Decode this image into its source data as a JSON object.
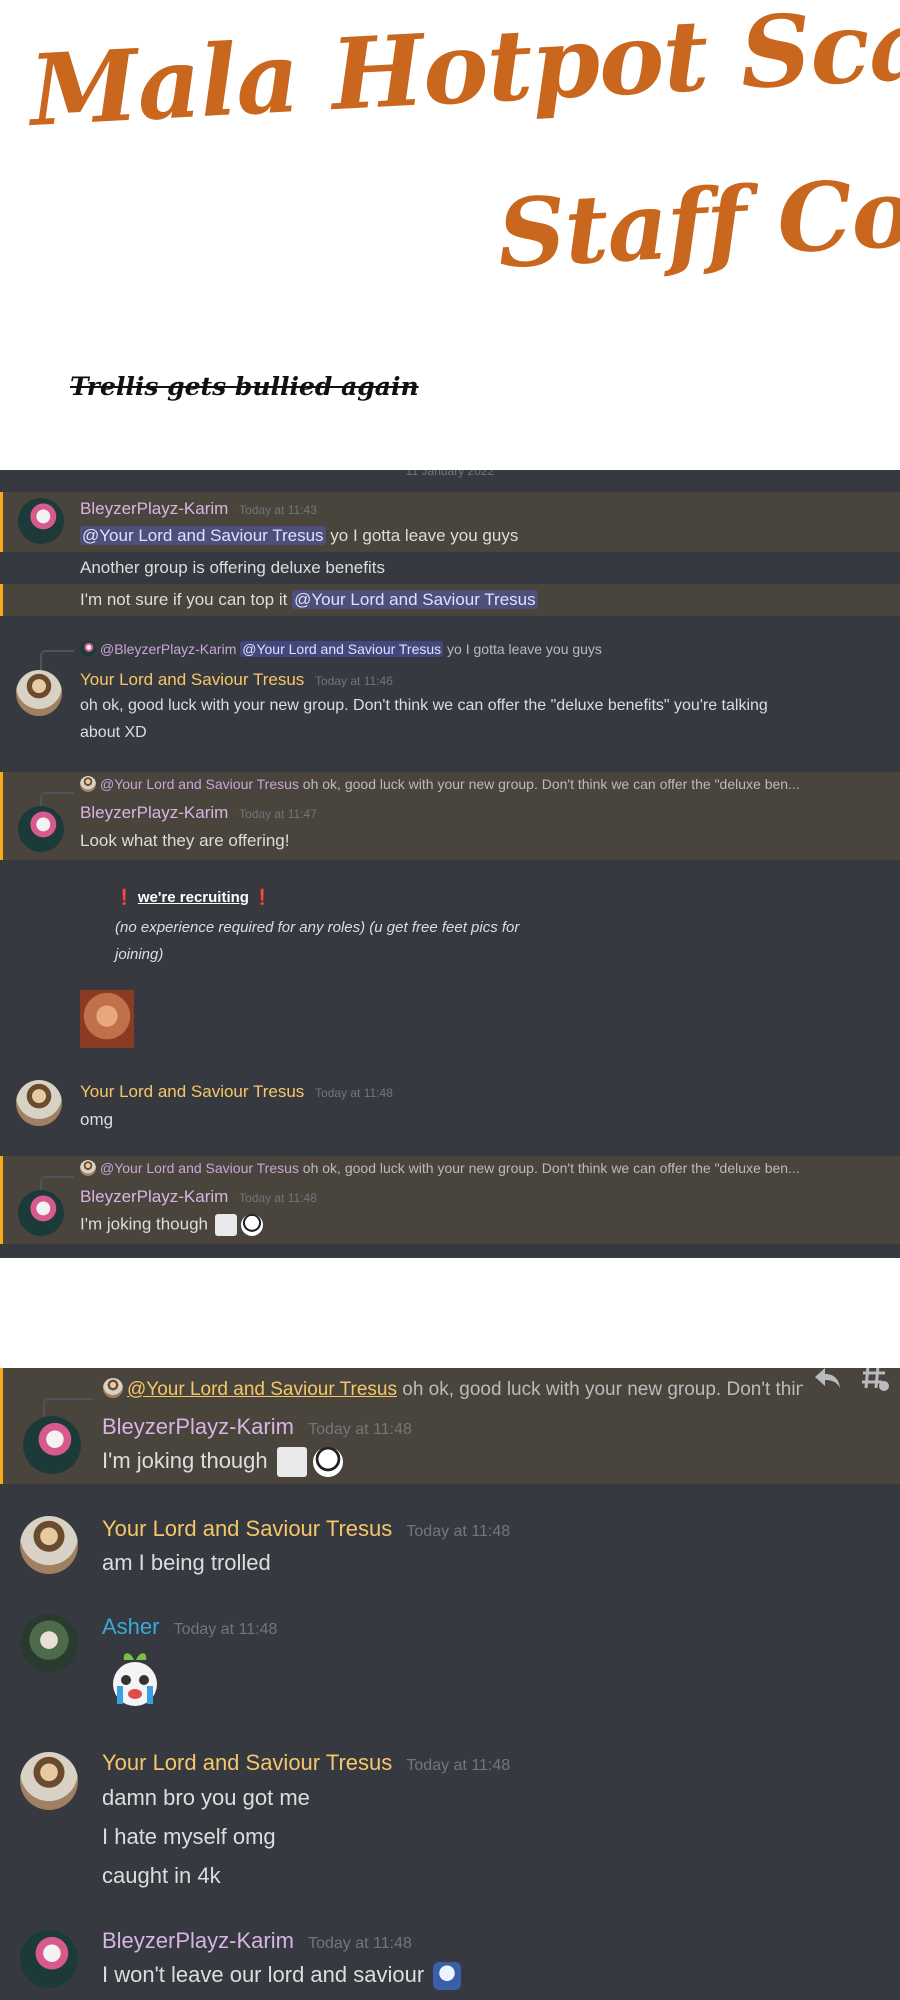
{
  "header": {
    "title_line1": "Mala Hotpot Scans",
    "title_line2": "Staff Corner",
    "subtitle": "Trellis gets bullied again"
  },
  "panel1": {
    "date_divider": "11 January 2022",
    "m1": {
      "author": "BleyzerPlayz-Karim",
      "time": "Today at 11:43",
      "line1_mention": "@Your Lord and Saviour Tresus",
      "line1_text": " yo I gotta leave you guys",
      "line2": "Another group is offering deluxe benefits",
      "line3_text": "I'm not sure if you can top it ",
      "line3_mention": "@Your Lord and Saviour Tresus"
    },
    "m2": {
      "reply_author": "@BleyzerPlayz-Karim",
      "reply_mention": "@Your Lord and Saviour Tresus",
      "reply_text": " yo I gotta leave you guys",
      "author": "Your Lord and Saviour Tresus",
      "time": "Today at 11:46",
      "text_line1": "oh ok, good luck with your new group. Don't think we can offer the \"deluxe benefits\" you're talking",
      "text_line2": "about XD"
    },
    "m3": {
      "reply_author": "@Your Lord and Saviour Tresus",
      "reply_text": " oh ok, good luck with your new group. Don't think we can offer the \"deluxe ben...",
      "author": "BleyzerPlayz-Karim",
      "time": "Today at 11:47",
      "text": "Look what they are offering!",
      "embed_excl": "❗",
      "embed_title": "we're recruiting",
      "embed_desc": "(no experience required for any roles) (u get free feet pics for joining)"
    },
    "m4": {
      "author": "Your Lord and Saviour Tresus",
      "time": "Today at 11:48",
      "text": "omg"
    },
    "m5": {
      "reply_author": "@Your Lord and Saviour Tresus",
      "reply_text": " oh ok, good luck with your new group. Don't think we can offer the \"deluxe ben...",
      "author": "BleyzerPlayz-Karim",
      "time": "Today at 11:48",
      "text": "I'm joking though"
    }
  },
  "panel2": {
    "m1": {
      "reply_author": "@Your Lord and Saviour Tresus",
      "reply_text": " oh ok, good luck with your new group. Don't thin",
      "author": "BleyzerPlayz-Karim",
      "time": "Today at 11:48",
      "text": "I'm joking though"
    },
    "m2": {
      "author": "Your Lord and Saviour Tresus",
      "time": "Today at 11:48",
      "text": "am I being trolled"
    },
    "m3": {
      "author": "Asher",
      "time": "Today at 11:48"
    },
    "m4": {
      "author": "Your Lord and Saviour Tresus",
      "time": "Today at 11:48",
      "line1": "damn bro you got me",
      "line2": "I hate myself omg",
      "line3": "caught in 4k"
    },
    "m5": {
      "author": "BleyzerPlayz-Karim",
      "time": "Today at 11:48",
      "text": "I won't leave our lord and saviour"
    },
    "icons": [
      "reply-icon",
      "create-thread-icon"
    ]
  },
  "colors": {
    "title": "#c9671f",
    "panel_bg": "#36393f",
    "highlight_bg": "#49443c",
    "highlight_border": "#faa81a",
    "karim_name": "#d8b4e4",
    "tresus_name": "#f6c768",
    "asher_name": "#3ba9d9"
  }
}
